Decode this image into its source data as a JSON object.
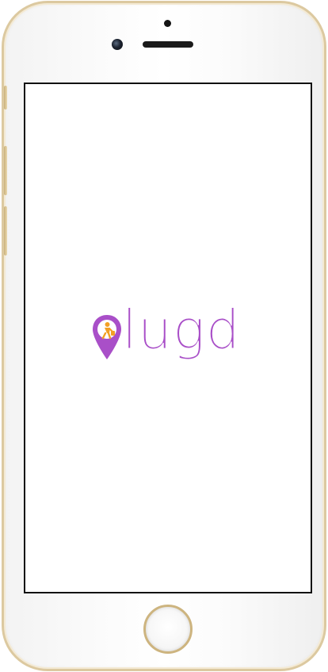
{
  "app": {
    "name": "lugd"
  },
  "splash": {
    "wordmark": "lugd",
    "brand_color": "#a94fc8",
    "accent_color": "#f2a024",
    "logo_icon": "map-pin-person-icon"
  },
  "device": {
    "model": "iphone-gold",
    "frame_color": "#dcc9a0"
  }
}
